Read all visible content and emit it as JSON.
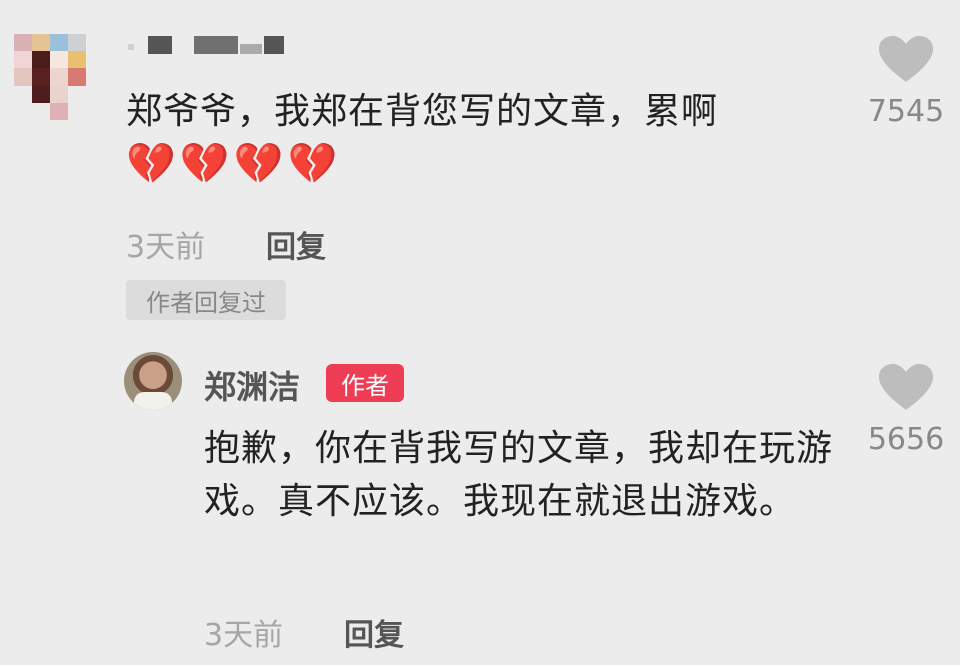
{
  "comment": {
    "text": "郑爷爷，我郑在背您写的文章，累啊",
    "emojis": [
      "💔",
      "💔",
      "💔",
      "💔"
    ],
    "time": "3天前",
    "reply_label": "回复",
    "author_replied_badge": "作者回复过",
    "likes": "7545"
  },
  "reply": {
    "author_name": "郑渊洁",
    "author_tag": "作者",
    "text": "抱歉，你在背我写的文章，我却在玩游戏。真不应该。我现在就退出游戏。",
    "time": "3天前",
    "reply_label": "回复",
    "likes": "5656"
  },
  "colors": {
    "background": "#ececec",
    "author_tag": "#ef3c55",
    "heart_icon": "#bdbdbd",
    "broken_heart": "#e4333c"
  }
}
